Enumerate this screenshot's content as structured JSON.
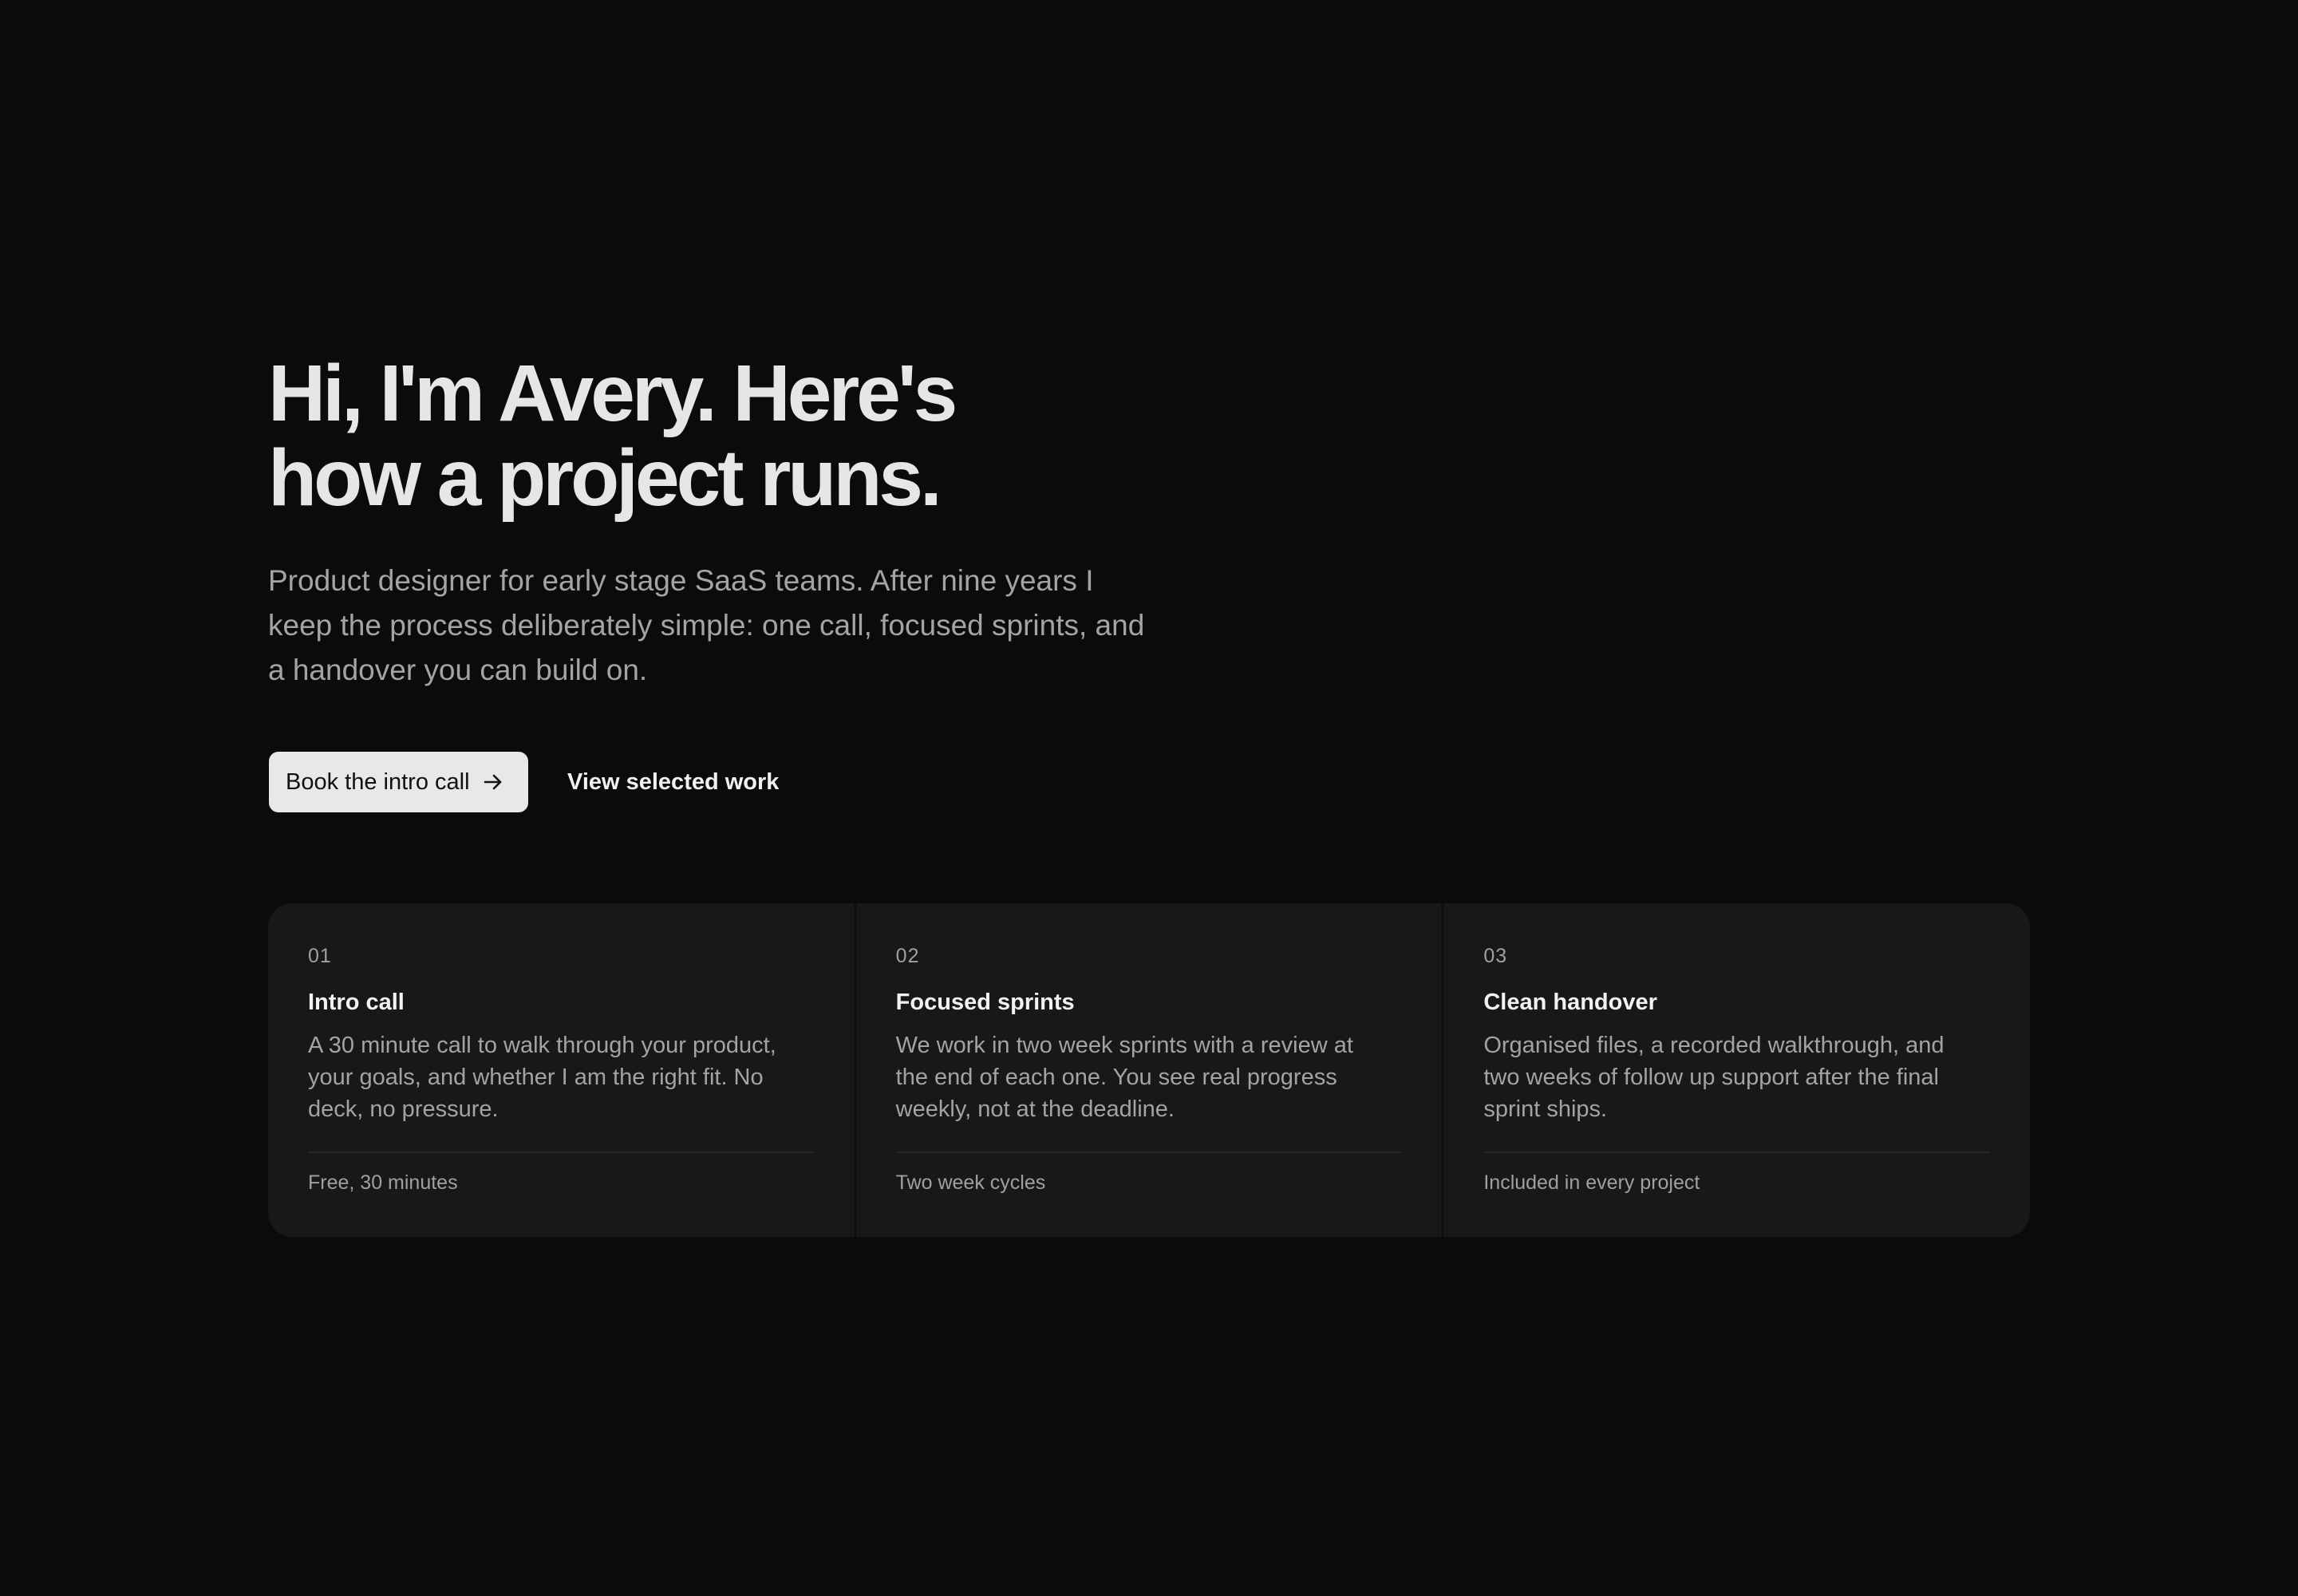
{
  "hero": {
    "headline_lines": [
      "Hi, I'm Avery. Here's",
      "how a project runs."
    ],
    "subtitle_lines": [
      "Product designer for early stage SaaS teams. After nine years I",
      "keep the process deliberately simple: one call, focused sprints, and",
      "a handover you can build on."
    ]
  },
  "actions": {
    "primary_label": "Book the intro call",
    "primary_icon": "arrow-right-icon",
    "secondary_label": "View selected work"
  },
  "steps": [
    {
      "number": "01",
      "title": "Intro call",
      "description_lines": [
        "A 30 minute call to walk through your product,",
        "your goals, and whether I am the right fit. No",
        "deck, no pressure."
      ],
      "meta": "Free, 30 minutes"
    },
    {
      "number": "02",
      "title": "Focused sprints",
      "description_lines": [
        "We work in two week sprints with a review at",
        "the end of each one. You see real progress",
        "weekly, not at the deadline."
      ],
      "meta": "Two week cycles"
    },
    {
      "number": "03",
      "title": "Clean handover",
      "description_lines": [
        "Organised files, a recorded walkthrough, and",
        "two weeks of follow up support after the final",
        "sprint ships."
      ],
      "meta": "Included in every project"
    }
  ],
  "colors": {
    "background": "#0b0b0b",
    "card": "#181818",
    "primary_button": "#e8e8e8",
    "heading": "#e6e6e6",
    "muted_text": "#a4a4a4"
  }
}
